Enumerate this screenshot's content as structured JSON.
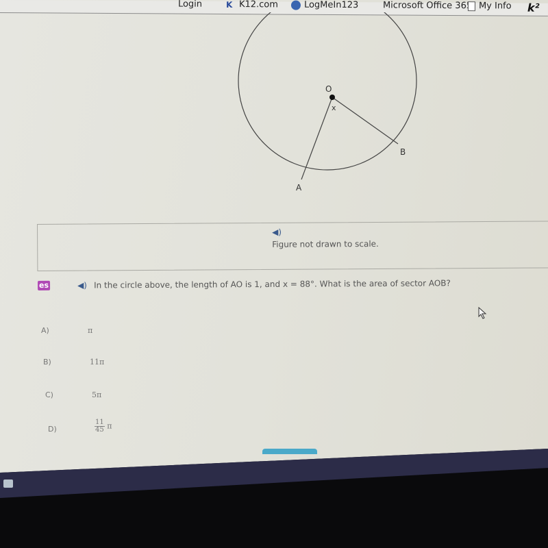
{
  "bookmarks_bar": {
    "items": [
      {
        "label": "Login",
        "icon": "bookmark-icon"
      },
      {
        "label": "K12.com",
        "icon": "k12-icon"
      },
      {
        "label": "LogMeIn123",
        "icon": "logmein-icon"
      },
      {
        "label": "Microsoft Office 365",
        "icon": "microsoft-icon"
      },
      {
        "label": "My Info",
        "icon": "document-icon"
      },
      {
        "label": "",
        "icon": "k2-icon"
      }
    ]
  },
  "figure": {
    "center_label": "O",
    "angle_label": "x",
    "point_a_label": "A",
    "point_b_label": "B"
  },
  "note": {
    "audio_icon": "speaker-icon",
    "text": "Figure not drawn to scale."
  },
  "question": {
    "badge": "es",
    "audio_icon": "speaker-icon",
    "text": "In the circle above, the length of AO is 1, and x = 88°. What is the area of sector AOB?"
  },
  "choices": [
    {
      "letter": "A)",
      "value": "π"
    },
    {
      "letter": "B)",
      "value": "11π"
    },
    {
      "letter": "C)",
      "value": "5π"
    },
    {
      "letter": "D)",
      "numerator": "11",
      "denominator": "45",
      "suffix": "π"
    }
  ],
  "colors": {
    "badge": "#b04ab5",
    "speaker": "#3a5a8c",
    "scroll_tab": "#4aa9c9"
  }
}
